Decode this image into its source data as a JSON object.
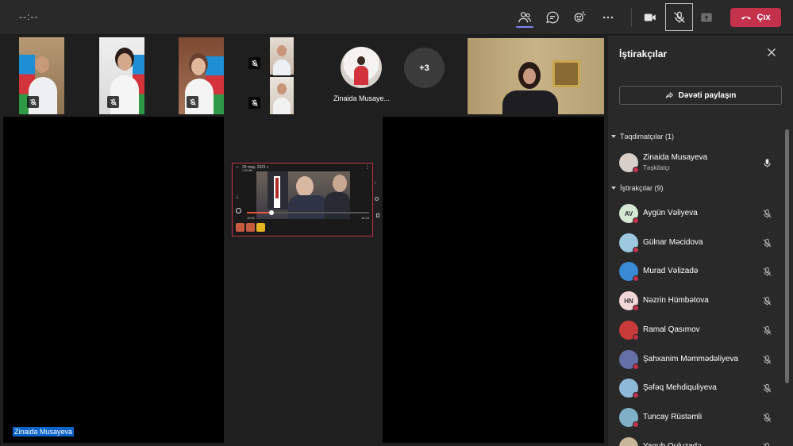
{
  "meeting": {
    "timer": "--:--",
    "leave_label": "Çıx"
  },
  "thumbnails": {
    "avatar_name": "Zinaida Musaye...",
    "overflow_count": "+3"
  },
  "stage": {
    "pinned_name": "Zinaida Musayeva",
    "shared_screen": {
      "date_text": "29 may, 2021 г.",
      "sub_text": "1:09 AM",
      "time_left": "13:31",
      "time_right": "15:18",
      "progress": 0.2
    }
  },
  "panel": {
    "title": "İştirakçılar",
    "invite_label": "Dəvəti paylaşın",
    "presenters_header": "Təqdimatçılar (1)",
    "attendees_header": "İştirakçılar (9)",
    "presenters": [
      {
        "name": "Zinaida Musayeva",
        "role": "Təşkilatçı",
        "initials": "",
        "avatar_color": "#d9cfc9",
        "mic": "on"
      }
    ],
    "attendees": [
      {
        "name": "Aygün Vəliyeva",
        "initials": "AV",
        "avatar_color": "#d5e8d4",
        "mic": "off"
      },
      {
        "name": "Gülnar Məcidova",
        "initials": "",
        "avatar_color": "#9ec8e0",
        "mic": "off"
      },
      {
        "name": "Murad Vəlizadə",
        "initials": "",
        "avatar_color": "#3a8ad6",
        "mic": "off"
      },
      {
        "name": "Nəzrin Hümbətova",
        "initials": "HN",
        "avatar_color": "#f3d6d6",
        "mic": "off"
      },
      {
        "name": "Ramal Qasımov",
        "initials": "",
        "avatar_color": "#c93a3a",
        "mic": "off"
      },
      {
        "name": "Şahxanim Məmmədəliyeva",
        "initials": "",
        "avatar_color": "#6670a8",
        "mic": "off"
      },
      {
        "name": "Şəfəq Mehdiquliyeva",
        "initials": "",
        "avatar_color": "#8fb9d8",
        "mic": "off"
      },
      {
        "name": "Tuncay Rüstəmli",
        "initials": "",
        "avatar_color": "#7fb0c8",
        "mic": "off"
      },
      {
        "name": "Yaqub Quluzadə",
        "initials": "",
        "avatar_color": "#c9b79a",
        "mic": "off"
      }
    ]
  },
  "colors": {
    "accent": "#7f85f5",
    "leave": "#c4314b",
    "name_label": "#0a63c9"
  }
}
